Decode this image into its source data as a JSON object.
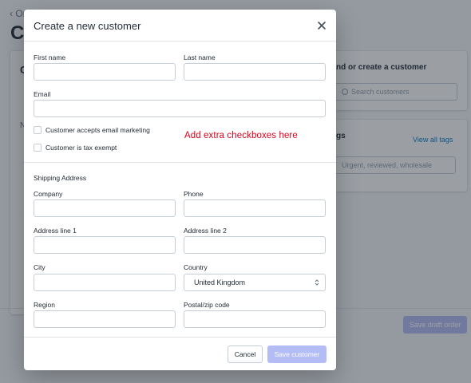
{
  "background": {
    "back_link": "‹ Or",
    "page_title_fragment": "Cr",
    "left_heading_fragment": "C",
    "left_label_fragment": "N",
    "find_customer_heading": "nd or create a customer",
    "search_placeholder": "Search customers",
    "tags_heading": "gs",
    "view_all_tags": "View all tags",
    "tags_placeholder": "Urgent, reviewed, wholesale",
    "save_draft_order": "Save draft order"
  },
  "modal": {
    "title": "Create a new customer",
    "close_icon": "close-icon",
    "fields": {
      "first_name_label": "First name",
      "first_name_value": "",
      "last_name_label": "Last name",
      "last_name_value": "",
      "email_label": "Email",
      "email_value": ""
    },
    "checkboxes": {
      "email_marketing": "Customer accepts email marketing",
      "tax_exempt": "Customer is tax exempt"
    },
    "annotation": "Add extra checkboxes here",
    "shipping": {
      "section_title": "Shipping Address",
      "company_label": "Company",
      "phone_label": "Phone",
      "address1_label": "Address line 1",
      "address2_label": "Address line 2",
      "city_label": "City",
      "country_label": "Country",
      "country_value": "United Kingdom",
      "region_label": "Region",
      "postal_label": "Postal/zip code"
    },
    "footer": {
      "cancel_label": "Cancel",
      "save_label": "Save customer"
    }
  },
  "colors": {
    "annotation": "#e0001b",
    "primary_disabled": "#b3bcf5",
    "link": "#007ace"
  }
}
